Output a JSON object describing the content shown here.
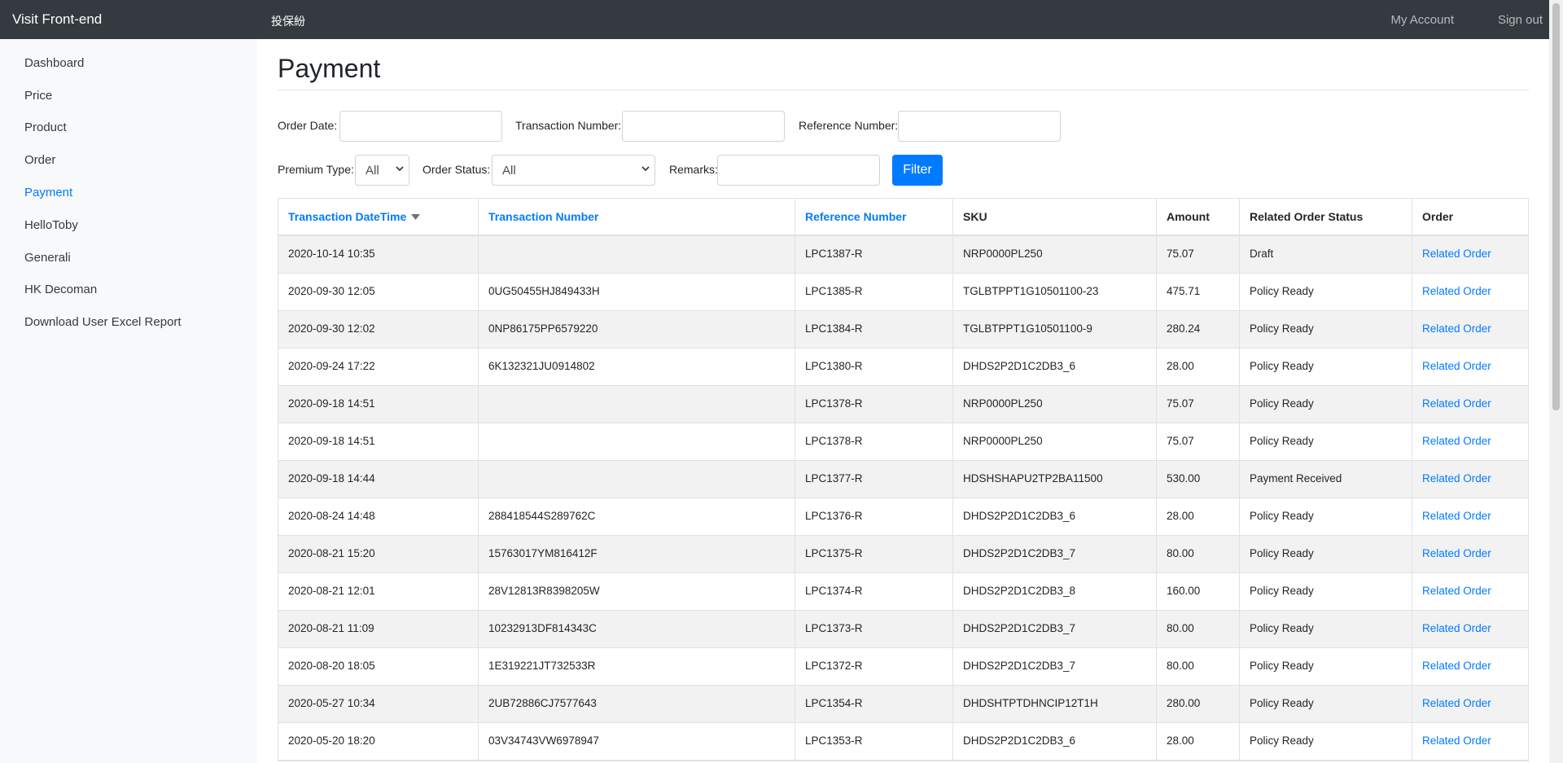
{
  "topbar": {
    "brand": "Visit Front-end",
    "center_label": "投保紛",
    "my_account": "My Account",
    "sign_out": "Sign out"
  },
  "sidebar": {
    "items": [
      {
        "label": "Dashboard",
        "active": false
      },
      {
        "label": "Price",
        "active": false
      },
      {
        "label": "Product",
        "active": false
      },
      {
        "label": "Order",
        "active": false
      },
      {
        "label": "Payment",
        "active": true
      },
      {
        "label": "HelloToby",
        "active": false
      },
      {
        "label": "Generali",
        "active": false
      },
      {
        "label": "HK Decoman",
        "active": false
      },
      {
        "label": "Download User Excel Report",
        "active": false
      }
    ]
  },
  "page": {
    "title": "Payment"
  },
  "filters": {
    "order_date_label": "Order Date:",
    "order_date_value": "",
    "transaction_number_label": "Transaction Number:",
    "transaction_number_value": "",
    "reference_number_label": "Reference Number:",
    "reference_number_value": "",
    "premium_type_label": "Premium Type:",
    "premium_type_value": "All",
    "order_status_label": "Order Status:",
    "order_status_value": "All",
    "remarks_label": "Remarks:",
    "remarks_value": "",
    "filter_button": "Filter"
  },
  "table": {
    "columns": [
      "Transaction DateTime",
      "Transaction Number",
      "Reference Number",
      "SKU",
      "Amount",
      "Related Order Status",
      "Order"
    ],
    "rows": [
      [
        "2020-10-14 10:35",
        "",
        "LPC1387-R",
        "NRP0000PL250",
        "75.07",
        "Draft",
        "Related Order"
      ],
      [
        "2020-09-30 12:05",
        "0UG50455HJ849433H",
        "LPC1385-R",
        "TGLBTPPT1G10501100-23",
        "475.71",
        "Policy Ready",
        "Related Order"
      ],
      [
        "2020-09-30 12:02",
        "0NP86175PP6579220",
        "LPC1384-R",
        "TGLBTPPT1G10501100-9",
        "280.24",
        "Policy Ready",
        "Related Order"
      ],
      [
        "2020-09-24 17:22",
        "6K132321JU0914802",
        "LPC1380-R",
        "DHDS2P2D1C2DB3_6",
        "28.00",
        "Policy Ready",
        "Related Order"
      ],
      [
        "2020-09-18 14:51",
        "",
        "LPC1378-R",
        "NRP0000PL250",
        "75.07",
        "Policy Ready",
        "Related Order"
      ],
      [
        "2020-09-18 14:51",
        "",
        "LPC1378-R",
        "NRP0000PL250",
        "75.07",
        "Policy Ready",
        "Related Order"
      ],
      [
        "2020-09-18 14:44",
        "",
        "LPC1377-R",
        "HDSHSHAPU2TP2BA11500",
        "530.00",
        "Payment Received",
        "Related Order"
      ],
      [
        "2020-08-24 14:48",
        "288418544S289762C",
        "LPC1376-R",
        "DHDS2P2D1C2DB3_6",
        "28.00",
        "Policy Ready",
        "Related Order"
      ],
      [
        "2020-08-21 15:20",
        "15763017YM816412F",
        "LPC1375-R",
        "DHDS2P2D1C2DB3_7",
        "80.00",
        "Policy Ready",
        "Related Order"
      ],
      [
        "2020-08-21 12:01",
        "28V12813R8398205W",
        "LPC1374-R",
        "DHDS2P2D1C2DB3_8",
        "160.00",
        "Policy Ready",
        "Related Order"
      ],
      [
        "2020-08-21 11:09",
        "10232913DF814343C",
        "LPC1373-R",
        "DHDS2P2D1C2DB3_7",
        "80.00",
        "Policy Ready",
        "Related Order"
      ],
      [
        "2020-08-20 18:05",
        "1E319221JT732533R",
        "LPC1372-R",
        "DHDS2P2D1C2DB3_7",
        "80.00",
        "Policy Ready",
        "Related Order"
      ],
      [
        "2020-05-27 10:34",
        "2UB72886CJ7577643",
        "LPC1354-R",
        "DHDSHTPTDHNCIP12T1H",
        "280.00",
        "Policy Ready",
        "Related Order"
      ],
      [
        "2020-05-20 18:20",
        "03V34743VW6978947",
        "LPC1353-R",
        "DHDS2P2D1C2DB3_6",
        "28.00",
        "Policy Ready",
        "Related Order"
      ]
    ]
  },
  "colors": {
    "topbar": "#343a40",
    "link": "#007bff",
    "sidebar_bg": "#f8f9fa"
  }
}
